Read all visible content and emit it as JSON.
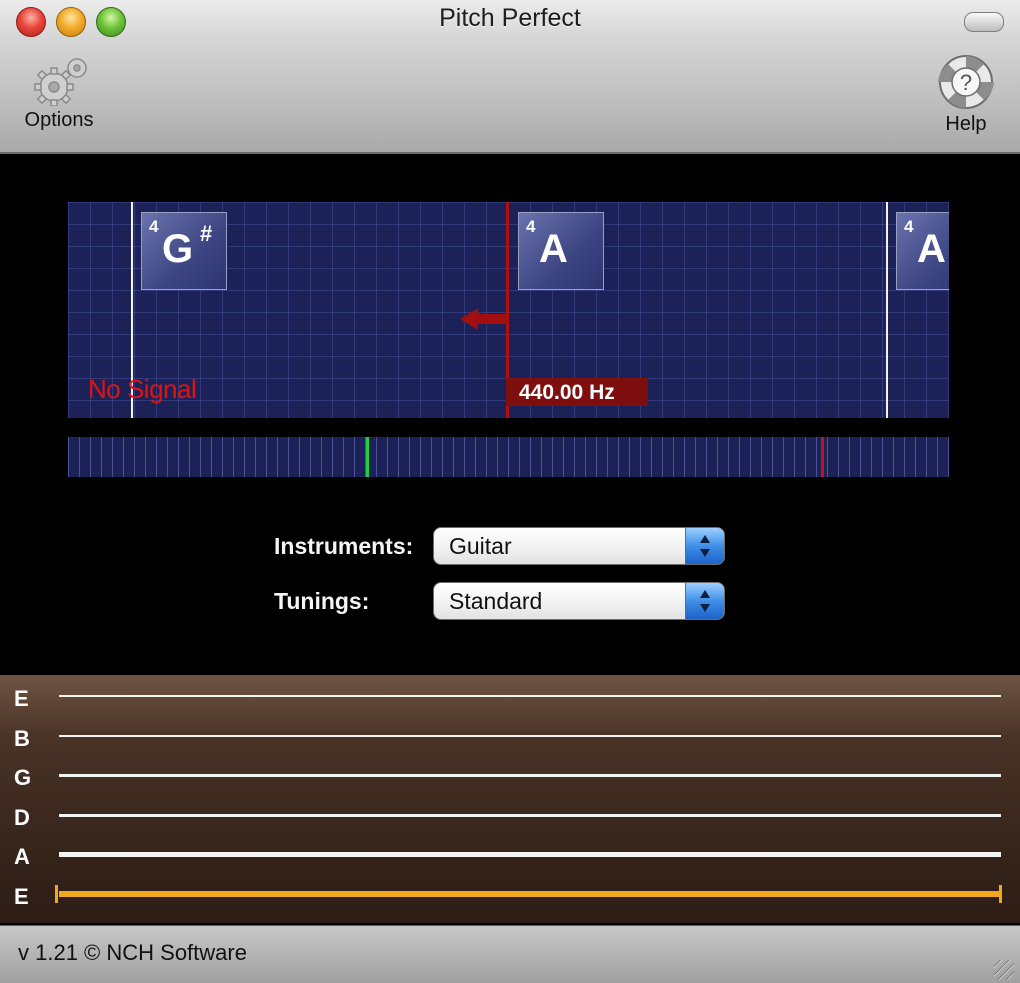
{
  "window": {
    "title": "Pitch Perfect"
  },
  "toolbar": {
    "options_label": "Options",
    "options_icon": "gears-icon",
    "help_label": "Help",
    "help_icon": "help-lifebuoy-icon"
  },
  "tuner": {
    "notes": [
      {
        "octave": "4",
        "name": "G",
        "accidental": "#"
      },
      {
        "octave": "4",
        "name": "A",
        "accidental": ""
      },
      {
        "octave": "4",
        "name": "A",
        "accidental": ""
      }
    ],
    "status": "No Signal",
    "frequency": "440.00 Hz",
    "colors": {
      "background": "#1c2258",
      "indicator": "#b01010",
      "status": "#e01212"
    }
  },
  "meter": {
    "colors": {
      "green": "#1dd23a",
      "red": "#c0161b"
    }
  },
  "form": {
    "instruments_label": "Instruments:",
    "instruments_value": "Guitar",
    "tunings_label": "Tunings:",
    "tunings_value": "Standard"
  },
  "strings": [
    {
      "label": "E",
      "active": false
    },
    {
      "label": "B",
      "active": false
    },
    {
      "label": "G",
      "active": false
    },
    {
      "label": "D",
      "active": false
    },
    {
      "label": "A",
      "active": false
    },
    {
      "label": "E",
      "active": true
    }
  ],
  "statusbar": {
    "text": "v 1.21 © NCH Software"
  }
}
